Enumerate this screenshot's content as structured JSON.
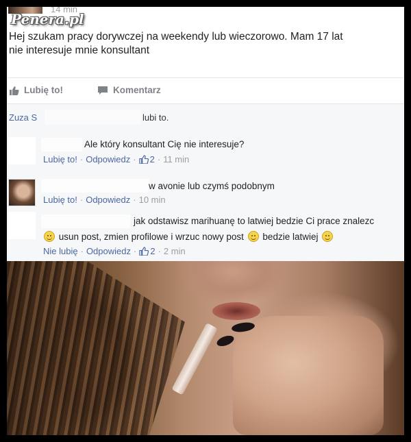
{
  "watermark": "Penera.pl",
  "post": {
    "time": "14 min",
    "text_line1": "Hej szukam pracy dorywczej na weekendy lub wieczorowo. Mam 17 lat",
    "text_line2": "nie interesuje mnie konsultant"
  },
  "actions": {
    "like_label": "Lubię to!",
    "comment_label": "Komentarz"
  },
  "likes": {
    "name_prefix": "Zuza S",
    "suffix": "lubi to."
  },
  "comments": [
    {
      "text": "Ale który konsultant Cię nie interesuje?",
      "like_label": "Lubię to!",
      "reply_label": "Odpowiedz",
      "like_count": "2",
      "time": "11 min"
    },
    {
      "text": "w avonie lub czymś podobnym",
      "like_label": "Lubię to!",
      "reply_label": "Odpowiedz",
      "time": "10 min"
    },
    {
      "text_line1": "jak odstawisz marihuanę to latwiej bedzie Ci prace znalezc",
      "text_line2a": "usun post, zmien profilowe i wrzuc nowy post",
      "text_line2b": "bedzie latwiej",
      "like_label": "Nie lubię",
      "reply_label": "Odpowiedz",
      "like_count": "2",
      "time": "2 min"
    }
  ],
  "colors": {
    "link": "#4b67a1",
    "muted": "#9a9da3",
    "comments_bg": "#f6f7f9"
  }
}
